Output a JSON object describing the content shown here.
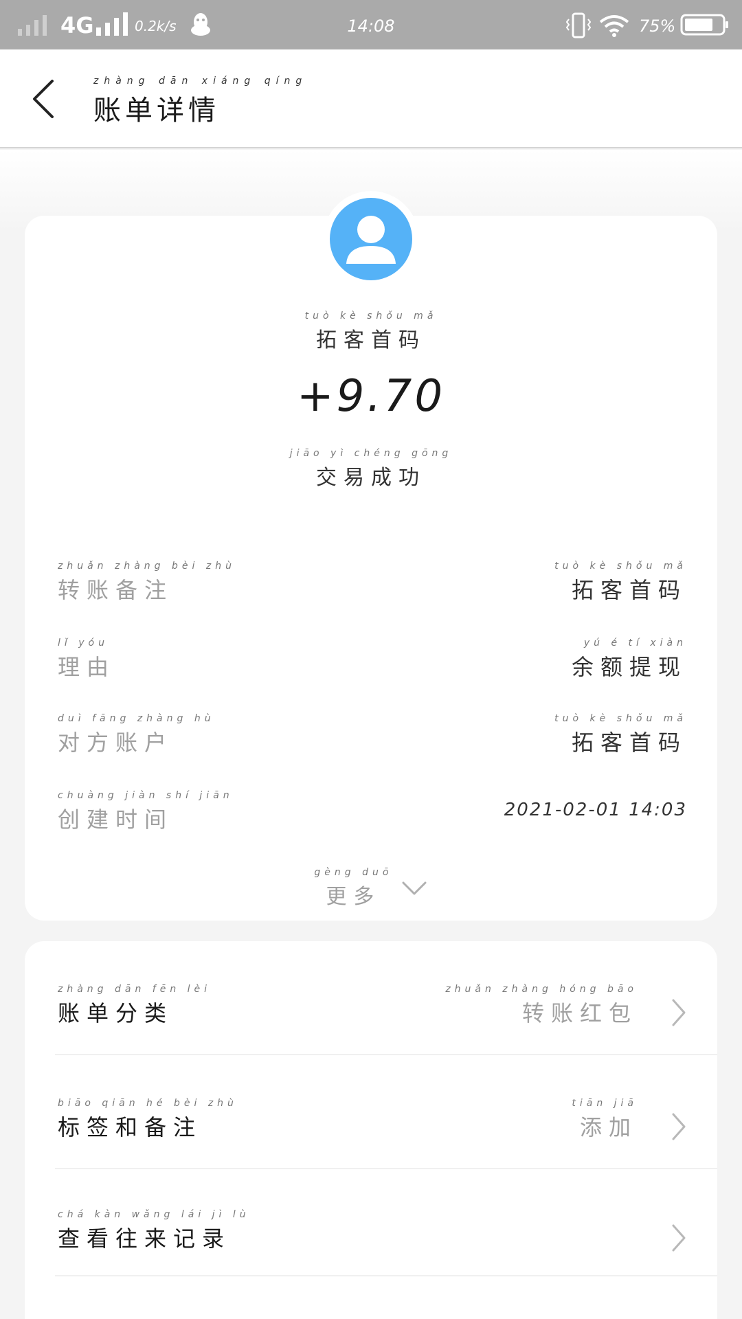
{
  "status_bar": {
    "network": "4G",
    "speed": "0.2k/s",
    "time": "14:08",
    "battery": "75%"
  },
  "header": {
    "title_pinyin": "zhàng dān xiáng qíng",
    "title": "账单详情"
  },
  "summary": {
    "payee_pinyin": "tuò kè shǒu mǎ",
    "payee": "拓客首码",
    "amount": "+9.70",
    "status_pinyin": "jiāo yì chéng gōng",
    "status": "交易成功"
  },
  "details": [
    {
      "label_pinyin": "zhuǎn zhàng bèi zhù",
      "label": "转账备注",
      "value_pinyin": "tuò kè shǒu mǎ",
      "value": "拓客首码"
    },
    {
      "label_pinyin": "lǐ yóu",
      "label": "理由",
      "value_pinyin": "yú é tí xiàn",
      "value": "余额提现"
    },
    {
      "label_pinyin": "duì fāng zhàng hù",
      "label": "对方账户",
      "value_pinyin": "tuò kè shǒu mǎ",
      "value": "拓客首码"
    },
    {
      "label_pinyin": "chuàng jiàn shí jiān",
      "label": "创建时间",
      "value_pinyin": "",
      "value": "2021-02-01 14:03"
    }
  ],
  "more": {
    "pinyin": "gèng duō",
    "label": "更多"
  },
  "options": [
    {
      "label_pinyin": "zhàng dān fēn lèi",
      "label": "账单分类",
      "value_pinyin": "zhuǎn zhàng hóng bāo",
      "value": "转账红包"
    },
    {
      "label_pinyin": "biāo qiān hé bèi zhù",
      "label": "标签和备注",
      "value_pinyin": "tiān jiā",
      "value": "添加"
    },
    {
      "label_pinyin": "chá kàn wǎng lái jì lù",
      "label": "查看往来记录",
      "value_pinyin": "",
      "value": ""
    }
  ],
  "colors": {
    "status_bar": "#aaaaaa",
    "avatar": "#55b2f7",
    "muted_text": "#a0a0a0",
    "page_bg": "#f4f4f4"
  }
}
